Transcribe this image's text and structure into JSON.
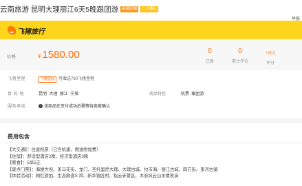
{
  "header": {
    "title": "云南旅游 昆明大理丽江6天5晚跟团游",
    "tags": [
      "高端定制",
      "二次确认"
    ],
    "report_label": "举报"
  },
  "brand": {
    "logo_text": "飞猪旅行"
  },
  "price_panel": {
    "label": "价格",
    "currency": "¥",
    "price": "1580.00",
    "stats": [
      {
        "value": "0",
        "label": "已售"
      },
      {
        "value": "0",
        "label": "累计评价"
      },
      {
        "value": "-",
        "suffix": "/5.0",
        "label": "评分"
      }
    ]
  },
  "mileage": {
    "label": "飞猪里程",
    "badge": "飞猪里程",
    "text": "可赠送790飞猪里程"
  },
  "destination": {
    "label": "目 的 地",
    "places": [
      "昆明",
      "大理",
      "丽江",
      "宁蒗"
    ],
    "features_label": "商品特色",
    "features": [
      "机票",
      "跟团游"
    ]
  },
  "service": {
    "label": "服务承诺",
    "text": "该商品在支付成功后需等待卖家确认"
  },
  "fee": {
    "title": "费用包含",
    "items": [
      "【大交通】：往返机票（已含机建、燃油附加费）",
      "【住宿】：舒适型酒店2晚，经济型酒店3晚",
      "【餐食】：5早5正",
      "【景点门票】：海埂大坝、茶马花街、龙门、圣托里尼大理、大理古城、拉市海、丽江古城、四方街、束河古镇",
      "【体验活动】：网红旅拍、生态廊道S 湾、新华银匠村、指云寺景区、木府风云山水情表演"
    ]
  },
  "colors": {
    "brand_yellow": "#ffd51c",
    "accent_orange": "#ff6a00"
  }
}
